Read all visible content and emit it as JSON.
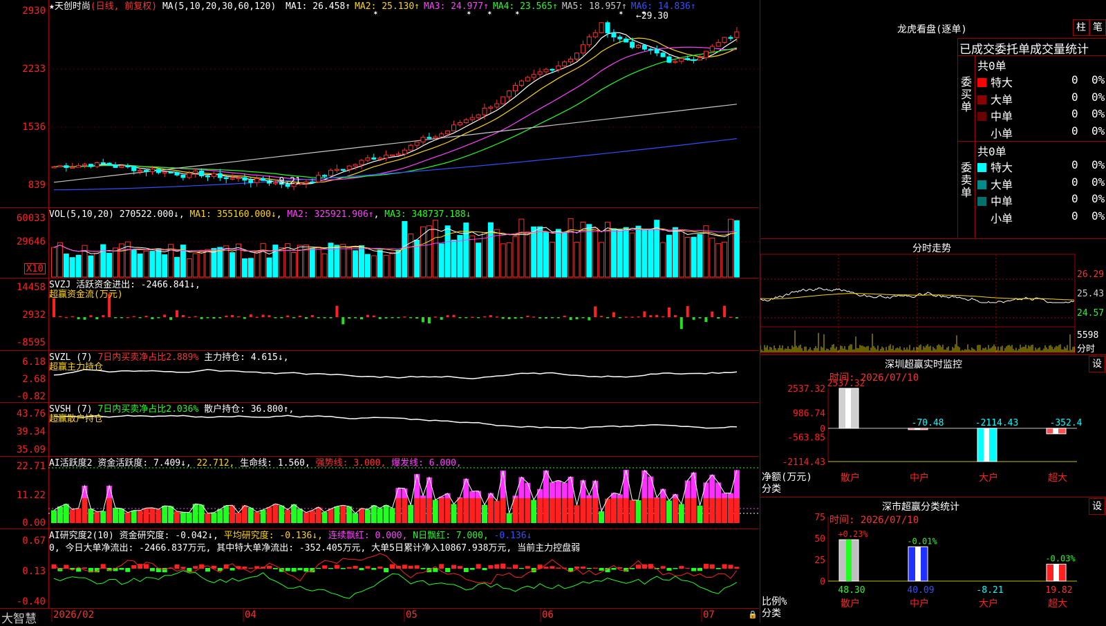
{
  "stock": {
    "title": "★天创时尚",
    "mode": "(日线, 前复权)",
    "ma_label": "MA(5,10,20,30,60,120)",
    "ma": [
      {
        "name": "MA1:",
        "value": "26.458↑",
        "color": "#ffffff"
      },
      {
        "name": "MA2:",
        "value": "25.130↑",
        "color": "#ffd700"
      },
      {
        "name": "MA3:",
        "value": "24.977↑",
        "color": "#ff40ff"
      },
      {
        "name": "MA4:",
        "value": "23.565↑",
        "color": "#20ff20"
      },
      {
        "name": "MA5:",
        "value": "18.957↑",
        "color": "#c8c8c8"
      },
      {
        "name": "MA6:",
        "value": "14.836↑",
        "color": "#3050ff"
      }
    ],
    "high_label": "29.30",
    "low_label": "9.21",
    "yaxis": [
      "2930",
      "2233",
      "1536",
      "839"
    ]
  },
  "vol": {
    "title": "VOL(5,10,20)",
    "value": "270522.000↓",
    "ma1": "MA1: 355160.000↓",
    "ma2": "MA2: 325921.906↑",
    "ma3": "MA3: 348737.188↓",
    "yaxis": [
      "60033",
      "29646"
    ],
    "unit": "X10"
  },
  "svzj": {
    "title": "SVZJ",
    "text": "活跃资金进出: -2466.841↓,",
    "sub": "超赢资金流(万元)",
    "yaxis": [
      "14458",
      "2932",
      "-8595"
    ]
  },
  "svzl": {
    "title": "SVZL (7)",
    "text1": "7日内买卖净占比2.889%",
    "text2": "主力持仓: 4.615↓,",
    "sub": "超赢主力持仓",
    "yaxis": [
      "6.18",
      "2.68",
      "-0.82"
    ]
  },
  "svsh": {
    "title": "SVSH (7)",
    "text1": "7日内买卖净占比2.036%",
    "text2": "散户持仓: 36.800↑,",
    "sub": "超赢散户持仓",
    "yaxis": [
      "43.76",
      "39.34",
      "35.09"
    ]
  },
  "ai1": {
    "title": "AI活跃度2",
    "t1": "资金活跃度: 7.409↓,",
    "t2": "22.712,",
    "t3": "生命线: 1.560,",
    "t4": "强势线: 3.000,",
    "t5": "爆发线: 6.000,",
    "yaxis": [
      "22.71",
      "11.22",
      "0.00"
    ]
  },
  "ai2": {
    "title": "AI研究度2(10)",
    "t1": "资金研究度: -0.042↓,",
    "t2": "平均研究度: -0.136↓,",
    "t3": "连续飘红: 0.000,",
    "t4": "N日飘红: 7.000,",
    "t5": "-0.136↓",
    "line2": "0, 今日大单净流出: -2466.837万元, 其中特大单净流出: -352.405万元, 大单5日累计净入10867.938万元, 当前主力控盘弱",
    "yaxis": [
      "0.67",
      "0.13",
      "-0.40"
    ]
  },
  "xaxis": {
    "brand": "大智慧",
    "dates": [
      "2026/02",
      "04",
      "05",
      "06",
      "07"
    ]
  },
  "dragon": {
    "title": "龙虎看盘(逐单)",
    "btn1": "柱",
    "btn2": "笔",
    "header": "已成交委托单成交量统计",
    "buy_label": "委买单",
    "sell_label": "委卖单",
    "buy_total": "共0单",
    "sell_total": "共0单",
    "buy_rows": [
      {
        "name": "特大",
        "v": "0",
        "p": "0%",
        "color": "#ff0000"
      },
      {
        "name": "大单",
        "v": "0",
        "p": "0%",
        "color": "#8b0000"
      },
      {
        "name": "中单",
        "v": "0",
        "p": "0%",
        "color": "#6a0000"
      },
      {
        "name": "小单",
        "v": "0",
        "p": "0%",
        "color": "#000000"
      }
    ],
    "sell_rows": [
      {
        "name": "特大",
        "v": "0",
        "p": "0%",
        "color": "#00ffff"
      },
      {
        "name": "大单",
        "v": "0",
        "p": "0%",
        "color": "#008b8b"
      },
      {
        "name": "中单",
        "v": "0",
        "p": "0%",
        "color": "#007070"
      },
      {
        "name": "小单",
        "v": "0",
        "p": "0%",
        "color": "#000000"
      }
    ]
  },
  "intraday": {
    "title": "分时走势",
    "prices": [
      "26.29",
      "25.43",
      "24.57"
    ],
    "vol_top": "5598",
    "vol_unit": "分时"
  },
  "monitor": {
    "title": "深圳超赢实时监控",
    "btn": "设",
    "time": "时间: 2026/07/10",
    "yaxis": [
      "2537.32",
      "986.74",
      "0",
      "-563.85",
      "-2114.43"
    ],
    "ylabel": "净额(万元)",
    "xlabel": "分类",
    "bars": [
      {
        "name": "散户",
        "value": 2537.32,
        "label": "2537.32"
      },
      {
        "name": "中户",
        "value": -70.48,
        "label": "-70.48"
      },
      {
        "name": "大户",
        "value": -2114.43,
        "label": "-2114.43"
      },
      {
        "name": "超大",
        "value": -352.4,
        "label": "-352.4"
      }
    ]
  },
  "classify": {
    "title": "深市超赢分类统计",
    "btn": "设",
    "time": "时间: 2026/07/10",
    "yaxis": [
      "75",
      "50",
      "25",
      "0"
    ],
    "ylabel": "比例%",
    "xlabel": "分类",
    "bars": [
      {
        "name": "散户",
        "value": 48.3,
        "label": "48.30",
        "pct": "+0.23%"
      },
      {
        "name": "中户",
        "value": 40.09,
        "label": "40.09",
        "pct": "-0.01%"
      },
      {
        "name": "大户",
        "value": -8.21,
        "label": "-8.21",
        "pct": ""
      },
      {
        "name": "超大",
        "value": 19.82,
        "label": "19.82",
        "pct": "-0.03%"
      }
    ]
  }
}
